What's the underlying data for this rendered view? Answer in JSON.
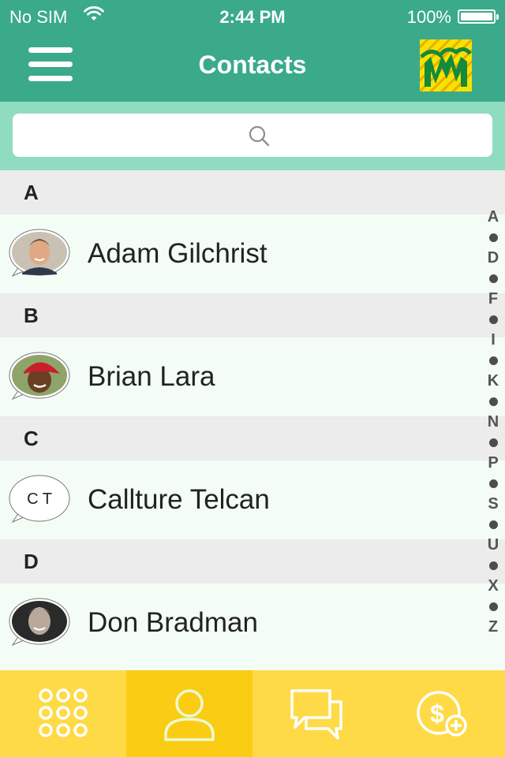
{
  "status_bar": {
    "carrier": "No SIM",
    "time": "2:44 PM",
    "battery": "100%"
  },
  "header": {
    "title": "Contacts"
  },
  "search": {
    "placeholder": ""
  },
  "sections": [
    {
      "letter": "A",
      "contacts": [
        {
          "name": "Adam Gilchrist"
        }
      ]
    },
    {
      "letter": "B",
      "contacts": [
        {
          "name": "Brian Lara"
        }
      ]
    },
    {
      "letter": "C",
      "contacts": [
        {
          "name": "Callture Telcan",
          "initials": "C T"
        }
      ]
    },
    {
      "letter": "D",
      "contacts": [
        {
          "name": "Don Bradman"
        }
      ]
    }
  ],
  "index_letters": [
    "A",
    "D",
    "F",
    "I",
    "K",
    "N",
    "P",
    "S",
    "U",
    "X",
    "Z"
  ],
  "tabbar": {
    "tabs": [
      {
        "name": "keypad-icon",
        "active": false
      },
      {
        "name": "contacts-icon",
        "active": true
      },
      {
        "name": "messages-icon",
        "active": false
      },
      {
        "name": "add-credit-icon",
        "active": false
      }
    ]
  },
  "colors": {
    "header": "#3aaa8a",
    "search_band": "#8fdcc0",
    "tabbar": "#ffda47",
    "tab_active": "#fbcc14",
    "row_bg": "#f3fdf6",
    "section_bg": "#ececec"
  }
}
